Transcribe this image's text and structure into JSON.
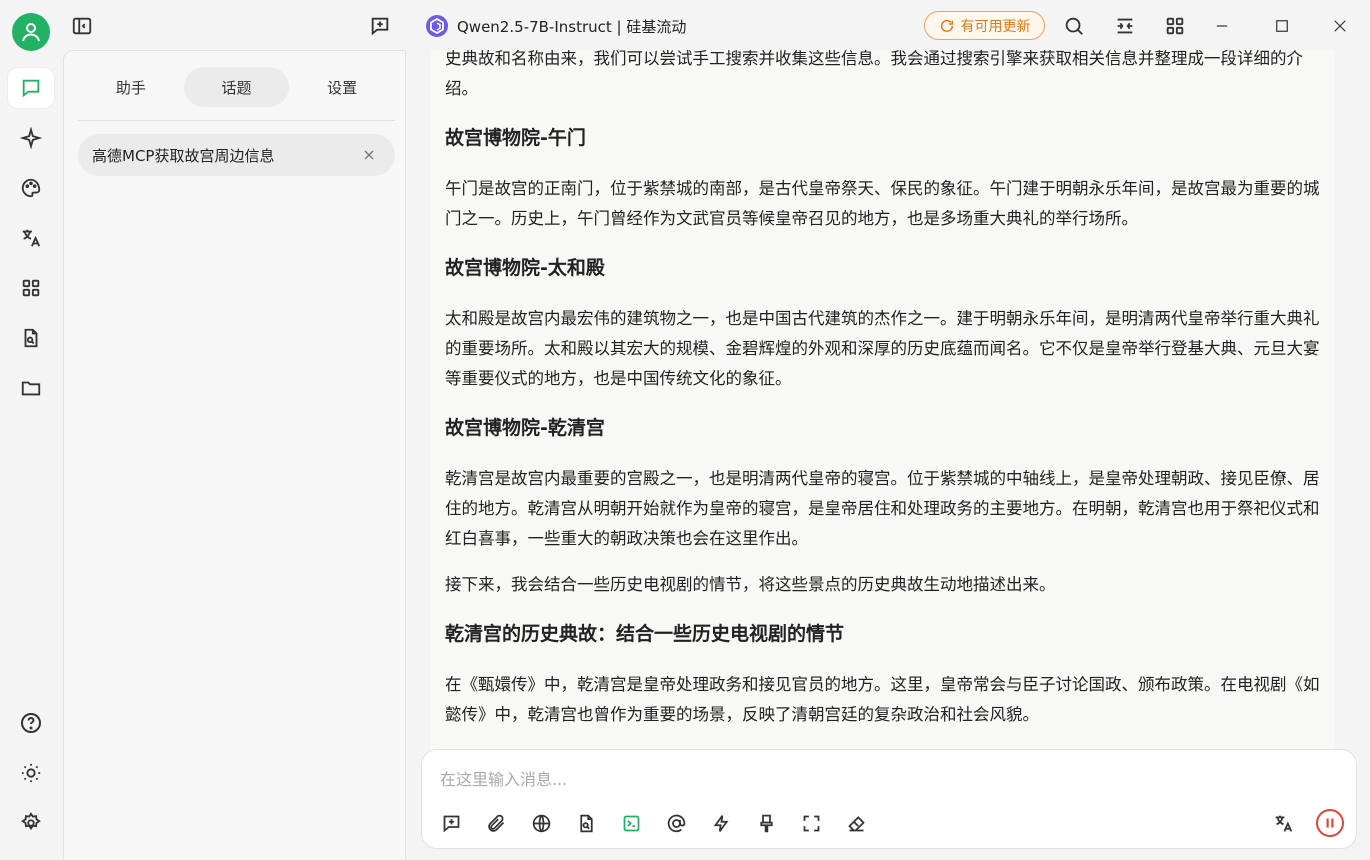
{
  "window": {
    "model_name": "Qwen2.5-7B-Instruct | 硅基流动",
    "update_label": "有可用更新"
  },
  "sidebar": {
    "tabs": [
      {
        "label": "助手",
        "active": false
      },
      {
        "label": "话题",
        "active": true
      },
      {
        "label": "设置",
        "active": false
      }
    ],
    "topic": "高德MCP获取故宫周边信息"
  },
  "content": {
    "intro": "史典故和名称由来，我们可以尝试手工搜索并收集这些信息。我会通过搜索引擎来获取相关信息并整理成一段详细的介绍。",
    "h1": "故宫博物院-午门",
    "p1": "午门是故宫的正南门，位于紫禁城的南部，是古代皇帝祭天、保民的象征。午门建于明朝永乐年间，是故宫最为重要的城门之一。历史上，午门曾经作为文武官员等候皇帝召见的地方，也是多场重大典礼的举行场所。",
    "h2": "故宫博物院-太和殿",
    "p2": "太和殿是故宫内最宏伟的建筑物之一，也是中国古代建筑的杰作之一。建于明朝永乐年间，是明清两代皇帝举行重大典礼的重要场所。太和殿以其宏大的规模、金碧辉煌的外观和深厚的历史底蕴而闻名。它不仅是皇帝举行登基大典、元旦大宴等重要仪式的地方，也是中国传统文化的象征。",
    "h3": "故宫博物院-乾清宫",
    "p3": "乾清宫是故宫内最重要的宫殿之一，也是明清两代皇帝的寝宫。位于紫禁城的中轴线上，是皇帝处理朝政、接见臣僚、居住的地方。乾清宫从明朝开始就作为皇帝的寝宫，是皇帝居住和处理政务的主要地方。在明朝，乾清宫也用于祭祀仪式和红白喜事，一些重大的朝政决策也会在这里作出。",
    "p4": "接下来，我会结合一些历史电视剧的情节，将这些景点的历史典故生动地描述出来。",
    "h4": "乾清宫的历史典故：结合一些历史电视剧的情节",
    "p5": "在《甄嬛传》中，乾清宫是皇帝处理政务和接见官员的地方。这里，皇帝常会与臣子讨论国政、颁布政策。在电视剧《如懿传》中，乾清宫也曾作为重要的场景，反映了清朝宫廷的复杂政治和社会风貌。"
  },
  "input": {
    "placeholder": "在这里输入消息...",
    "value": ""
  },
  "colors": {
    "accent": "#22b165",
    "update": "#e07a1f",
    "stop": "#e0443a"
  }
}
